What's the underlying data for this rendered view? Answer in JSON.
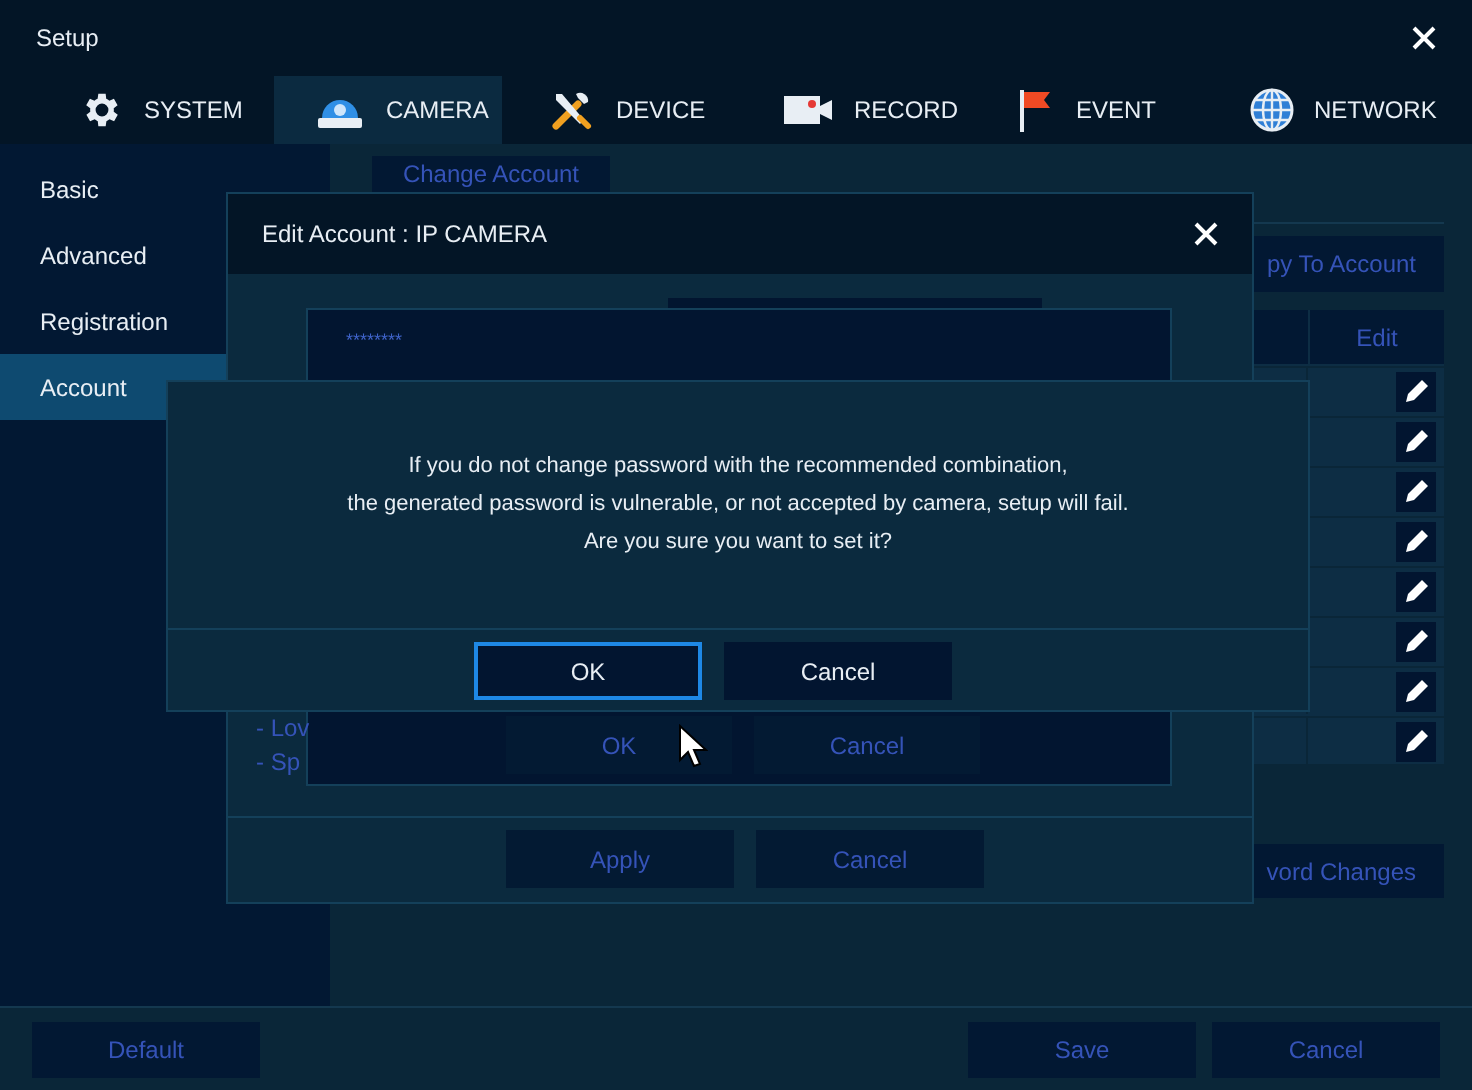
{
  "window": {
    "title": "Setup"
  },
  "tabs": [
    {
      "label": "SYSTEM",
      "selected": false
    },
    {
      "label": "CAMERA",
      "selected": true
    },
    {
      "label": "DEVICE",
      "selected": false
    },
    {
      "label": "RECORD",
      "selected": false
    },
    {
      "label": "EVENT",
      "selected": false
    },
    {
      "label": "NETWORK",
      "selected": false
    }
  ],
  "sidebar": {
    "items": [
      {
        "label": "Basic",
        "selected": false
      },
      {
        "label": "Advanced",
        "selected": false
      },
      {
        "label": "Registration",
        "selected": false
      },
      {
        "label": "Account",
        "selected": true
      }
    ]
  },
  "main": {
    "change_account_button": "Change Account",
    "copy_button": "py To Account",
    "table": {
      "columns": [
        "Edit"
      ],
      "rows": [
        {
          "kind": "edit"
        },
        {
          "kind": "edit"
        },
        {
          "kind": "edit"
        },
        {
          "kind": "edit"
        },
        {
          "kind": "edit"
        },
        {
          "kind": "edit"
        },
        {
          "kind": "edit"
        },
        {
          "kind": "edit"
        }
      ]
    },
    "password_changes_button": "vord Changes"
  },
  "edit_dialog": {
    "title": "Edit Account : IP CAMERA",
    "password": "********",
    "notes": [
      "- Lov",
      "- Sp"
    ],
    "inner_buttons": [
      "OK",
      "Cancel"
    ],
    "buttons": [
      "Apply",
      "Cancel"
    ]
  },
  "confirm_dialog": {
    "message": [
      "If you do not change password with the recommended combination,",
      "the generated password is vulnerable, or not accepted by camera, setup will fail.",
      "Are you sure you want to set it?"
    ],
    "buttons": [
      {
        "label": "OK",
        "selected": true
      },
      {
        "label": "Cancel",
        "selected": false
      }
    ]
  },
  "footer": {
    "left_buttons": [
      "Default"
    ],
    "right_buttons": [
      "Save",
      "Cancel"
    ]
  }
}
